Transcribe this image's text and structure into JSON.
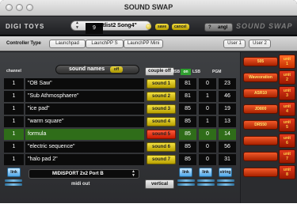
{
  "window": {
    "title": "SOUND SWAP"
  },
  "header": {
    "brand": "DIGI TOYS",
    "setlist_number": "9",
    "setlist_name": "\"Setlist2 Song4\"",
    "save_label": "save",
    "cancel_label": "cancel",
    "help_label": "?",
    "angl_label": "angl",
    "logo_text": "SOUND SWAP"
  },
  "controller": {
    "label": "Controller Type",
    "tabs": [
      "Launchpad",
      "LaunchPP S",
      "LaunchPP Mini"
    ],
    "user_tabs": [
      "User 1",
      "User 2"
    ]
  },
  "columns": {
    "channel": "channel",
    "sound_names": "sound names",
    "sound_names_toggle": "off",
    "couple": "couple off",
    "msb": "MSB",
    "msb_state": "on",
    "lsb": "LSB",
    "pgm": "PGM"
  },
  "rows": [
    {
      "channel": "1",
      "name": "\"OB Saw\"",
      "sound": "sound 1",
      "msb": "81",
      "lsb": "0",
      "pgm": "23"
    },
    {
      "channel": "1",
      "name": "\"Sub Athmosphaere\"",
      "sound": "sound 2",
      "msb": "81",
      "lsb": "1",
      "pgm": "46"
    },
    {
      "channel": "1",
      "name": "\"ice pad\"",
      "sound": "sound 3",
      "msb": "85",
      "lsb": "0",
      "pgm": "19"
    },
    {
      "channel": "1",
      "name": "\"warm square\"",
      "sound": "sound 4",
      "msb": "85",
      "lsb": "1",
      "pgm": "13"
    },
    {
      "channel": "1",
      "name": "formula",
      "sound": "sound 5",
      "msb": "85",
      "lsb": "0",
      "pgm": "14"
    },
    {
      "channel": "1",
      "name": "\"electric sequence\"",
      "sound": "sound 6",
      "msb": "85",
      "lsb": "0",
      "pgm": "56"
    },
    {
      "channel": "1",
      "name": "\"halo pad 2\"",
      "sound": "sound 7",
      "msb": "85",
      "lsb": "0",
      "pgm": "31"
    }
  ],
  "selected_row": 4,
  "bottom": {
    "link_label": "link",
    "midi_port": "MIDISPORT 2x2 Port B",
    "midi_out_label": "midi out",
    "vertical_label": "vertical",
    "string_label": "string"
  },
  "units": [
    {
      "name": "505",
      "unit": "unit 1"
    },
    {
      "name": "Waveoration",
      "unit": "unit 2"
    },
    {
      "name": "ASR10",
      "unit": "unit 3"
    },
    {
      "name": "JD800",
      "unit": "unit 4"
    },
    {
      "name": "DR550",
      "unit": "unit 5"
    },
    {
      "name": "",
      "unit": "unit 6"
    },
    {
      "name": "",
      "unit": "unit 7"
    },
    {
      "name": "",
      "unit": "unit 8"
    }
  ],
  "colors": {
    "accent_yellow": "#e2cc2a",
    "active_red": "#e8301a",
    "selected_green": "#2f6d19"
  }
}
